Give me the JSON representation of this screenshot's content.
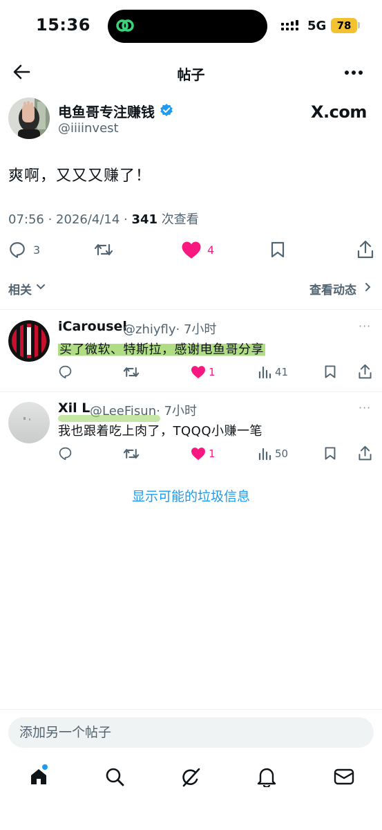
{
  "status_bar": {
    "time": "15:36",
    "network": "5G",
    "battery": "78"
  },
  "header": {
    "title": "帖子"
  },
  "post": {
    "author_name": "电鱼哥专注赚钱",
    "author_handle": "@iiiinvest",
    "watermark": "X.com",
    "text": "爽啊，又又又赚了！",
    "timestamp": "07:56 · 2026/4/14 · ",
    "view_count": "341",
    "view_label": " 次查看",
    "replies": "3",
    "likes": "4"
  },
  "related": {
    "label": "相关",
    "activity_label": "查看动态"
  },
  "replies": [
    {
      "name": "iCarousel",
      "handle": "@zhiyfly",
      "time": "· 7小时",
      "text": "买了微软、特斯拉，感谢电鱼哥分享",
      "likes": "1",
      "views": "41"
    },
    {
      "name": "Xil L",
      "handle": "@LeeFisun",
      "time": "· 7小时",
      "text": "我也跟着吃上肉了，TQQQ小赚一笔",
      "likes": "1",
      "views": "50"
    }
  ],
  "spam_link": "显示可能的垃圾信息",
  "compose": {
    "placeholder": "添加另一个帖子"
  },
  "colors": {
    "accent": "#1d9bf0",
    "like": "#f91880",
    "secondary_text": "#536471",
    "highlight": "#96d25a"
  },
  "icons": {
    "back": "arrow-left-icon",
    "more": "more-horizontal-icon",
    "reply": "speech-bubble-icon",
    "repost": "repost-icon",
    "like": "heart-icon",
    "bookmark": "bookmark-icon",
    "share": "share-icon",
    "views": "bar-chart-icon",
    "nav": [
      "home-icon",
      "search-icon",
      "grok-icon",
      "bell-icon",
      "mail-icon"
    ]
  }
}
